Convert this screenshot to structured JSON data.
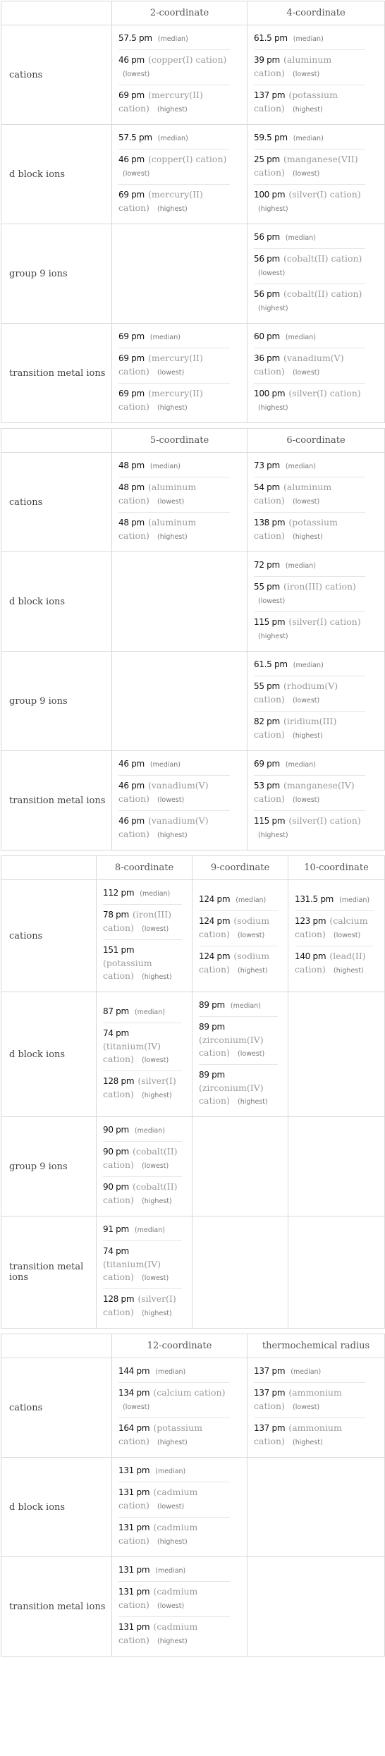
{
  "tables": [
    {
      "columns": [
        "2-coordinate",
        "4-coordinate"
      ],
      "rows": [
        {
          "label": "cations",
          "cells": [
            {
              "median": "57.5 pm",
              "lowest": {
                "value": "46 pm",
                "ion": "(copper(I) cation)"
              },
              "highest": {
                "value": "69 pm",
                "ion": "(mercury(II) cation)"
              }
            },
            {
              "median": "61.5 pm",
              "lowest": {
                "value": "39 pm",
                "ion": "(aluminum cation)"
              },
              "highest": {
                "value": "137 pm",
                "ion": "(potassium cation)"
              }
            }
          ]
        },
        {
          "label": "d block ions",
          "cells": [
            {
              "median": "57.5 pm",
              "lowest": {
                "value": "46 pm",
                "ion": "(copper(I) cation)"
              },
              "highest": {
                "value": "69 pm",
                "ion": "(mercury(II) cation)"
              }
            },
            {
              "median": "59.5 pm",
              "lowest": {
                "value": "25 pm",
                "ion": "(manganese(VII) cation)"
              },
              "highest": {
                "value": "100 pm",
                "ion": "(silver(I) cation)"
              }
            }
          ]
        },
        {
          "label": "group 9 ions",
          "cells": [
            null,
            {
              "median": "56 pm",
              "lowest": {
                "value": "56 pm",
                "ion": "(cobalt(II) cation)"
              },
              "highest": {
                "value": "56 pm",
                "ion": "(cobalt(II) cation)"
              }
            }
          ]
        },
        {
          "label": "transition metal ions",
          "cells": [
            {
              "median": "69 pm",
              "lowest": {
                "value": "69 pm",
                "ion": "(mercury(II) cation)"
              },
              "highest": {
                "value": "69 pm",
                "ion": "(mercury(II) cation)"
              }
            },
            {
              "median": "60 pm",
              "lowest": {
                "value": "36 pm",
                "ion": "(vanadium(V) cation)"
              },
              "highest": {
                "value": "100 pm",
                "ion": "(silver(I) cation)"
              }
            }
          ]
        }
      ]
    },
    {
      "columns": [
        "5-coordinate",
        "6-coordinate"
      ],
      "rows": [
        {
          "label": "cations",
          "cells": [
            {
              "median": "48 pm",
              "lowest": {
                "value": "48 pm",
                "ion": "(aluminum cation)"
              },
              "highest": {
                "value": "48 pm",
                "ion": "(aluminum cation)"
              }
            },
            {
              "median": "73 pm",
              "lowest": {
                "value": "54 pm",
                "ion": "(aluminum cation)"
              },
              "highest": {
                "value": "138 pm",
                "ion": "(potassium cation)"
              }
            }
          ]
        },
        {
          "label": "d block ions",
          "cells": [
            null,
            {
              "median": "72 pm",
              "lowest": {
                "value": "55 pm",
                "ion": "(iron(III) cation)"
              },
              "highest": {
                "value": "115 pm",
                "ion": "(silver(I) cation)"
              }
            }
          ]
        },
        {
          "label": "group 9 ions",
          "cells": [
            null,
            {
              "median": "61.5 pm",
              "lowest": {
                "value": "55 pm",
                "ion": "(rhodium(V) cation)"
              },
              "highest": {
                "value": "82 pm",
                "ion": "(iridium(III) cation)"
              }
            }
          ]
        },
        {
          "label": "transition metal ions",
          "cells": [
            {
              "median": "46 pm",
              "lowest": {
                "value": "46 pm",
                "ion": "(vanadium(V) cation)"
              },
              "highest": {
                "value": "46 pm",
                "ion": "(vanadium(V) cation)"
              }
            },
            {
              "median": "69 pm",
              "lowest": {
                "value": "53 pm",
                "ion": "(manganese(IV) cation)"
              },
              "highest": {
                "value": "115 pm",
                "ion": "(silver(I) cation)"
              }
            }
          ]
        }
      ]
    },
    {
      "columns": [
        "8-coordinate",
        "9-coordinate",
        "10-coordinate"
      ],
      "rows": [
        {
          "label": "cations",
          "cells": [
            {
              "median": "112 pm",
              "lowest": {
                "value": "78 pm",
                "ion": "(iron(III) cation)"
              },
              "highest": {
                "value": "151 pm",
                "ion": "(potassium cation)"
              }
            },
            {
              "median": "124 pm",
              "lowest": {
                "value": "124 pm",
                "ion": "(sodium cation)"
              },
              "highest": {
                "value": "124 pm",
                "ion": "(sodium cation)"
              }
            },
            {
              "median": "131.5 pm",
              "lowest": {
                "value": "123 pm",
                "ion": "(calcium cation)"
              },
              "highest": {
                "value": "140 pm",
                "ion": "(lead(II) cation)"
              }
            }
          ]
        },
        {
          "label": "d block ions",
          "cells": [
            {
              "median": "87 pm",
              "lowest": {
                "value": "74 pm",
                "ion": "(titanium(IV) cation)"
              },
              "highest": {
                "value": "128 pm",
                "ion": "(silver(I) cation)"
              }
            },
            {
              "median": "89 pm",
              "lowest": {
                "value": "89 pm",
                "ion": "(zirconium(IV) cation)"
              },
              "highest": {
                "value": "89 pm",
                "ion": "(zirconium(IV) cation)"
              }
            },
            null
          ]
        },
        {
          "label": "group 9 ions",
          "cells": [
            {
              "median": "90 pm",
              "lowest": {
                "value": "90 pm",
                "ion": "(cobalt(II) cation)"
              },
              "highest": {
                "value": "90 pm",
                "ion": "(cobalt(II) cation)"
              }
            },
            null,
            null
          ]
        },
        {
          "label": "transition metal ions",
          "cells": [
            {
              "median": "91 pm",
              "lowest": {
                "value": "74 pm",
                "ion": "(titanium(IV) cation)"
              },
              "highest": {
                "value": "128 pm",
                "ion": "(silver(I) cation)"
              }
            },
            null,
            null
          ]
        }
      ]
    },
    {
      "columns": [
        "12-coordinate",
        "thermochemical radius"
      ],
      "rows": [
        {
          "label": "cations",
          "cells": [
            {
              "median": "144 pm",
              "lowest": {
                "value": "134 pm",
                "ion": "(calcium cation)"
              },
              "highest": {
                "value": "164 pm",
                "ion": "(potassium cation)"
              }
            },
            {
              "median": "137 pm",
              "lowest": {
                "value": "137 pm",
                "ion": "(ammonium cation)"
              },
              "highest": {
                "value": "137 pm",
                "ion": "(ammonium cation)"
              }
            }
          ]
        },
        {
          "label": "d block ions",
          "cells": [
            {
              "median": "131 pm",
              "lowest": {
                "value": "131 pm",
                "ion": "(cadmium cation)"
              },
              "highest": {
                "value": "131 pm",
                "ion": "(cadmium cation)"
              }
            },
            null
          ]
        },
        {
          "label": "transition metal ions",
          "cells": [
            {
              "median": "131 pm",
              "lowest": {
                "value": "131 pm",
                "ion": "(cadmium cation)"
              },
              "highest": {
                "value": "131 pm",
                "ion": "(cadmium cation)"
              }
            },
            null
          ]
        }
      ]
    }
  ],
  "labels": {
    "median": "(median)",
    "lowest": "(lowest)",
    "highest": "(highest)"
  }
}
